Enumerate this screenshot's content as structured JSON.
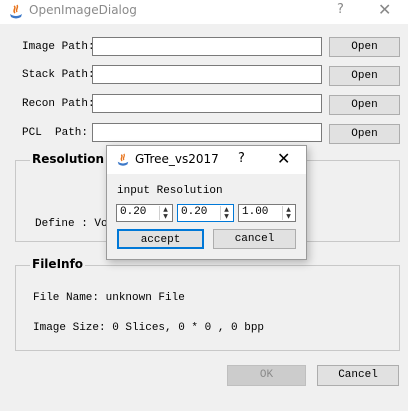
{
  "window": {
    "title": "OpenImageDialog",
    "help_glyph": "?",
    "close_glyph": "✕"
  },
  "paths": {
    "image": {
      "label": "Image Path:",
      "value": "",
      "button": "Open"
    },
    "stack": {
      "label": "Stack Path:",
      "value": "",
      "button": "Open"
    },
    "recon": {
      "label": "Recon Path:",
      "value": "",
      "button": "Open"
    },
    "pcl": {
      "label": "PCL  Path:",
      "value": "",
      "button": "Open"
    }
  },
  "resolution": {
    "title": "Resolution",
    "define_text": "Define : Vox"
  },
  "fileinfo": {
    "title": "FileInfo",
    "file_name": "File Name: unknown File",
    "image_size": "Image Size: 0 Slices, 0 * 0 , 0 bpp"
  },
  "footer": {
    "ok": "OK",
    "cancel": "Cancel"
  },
  "popup": {
    "title": "GTree_vs2017",
    "help_glyph": "?",
    "close_glyph": "✕",
    "prompt": "input Resolution",
    "values": [
      "0.20",
      "0.20",
      "1.00"
    ],
    "accept": "accept",
    "cancel": "cancel"
  },
  "colors": {
    "focus_accent": "#0078d7",
    "icon_orange": "#e8731b",
    "icon_blue": "#3c78c8"
  }
}
